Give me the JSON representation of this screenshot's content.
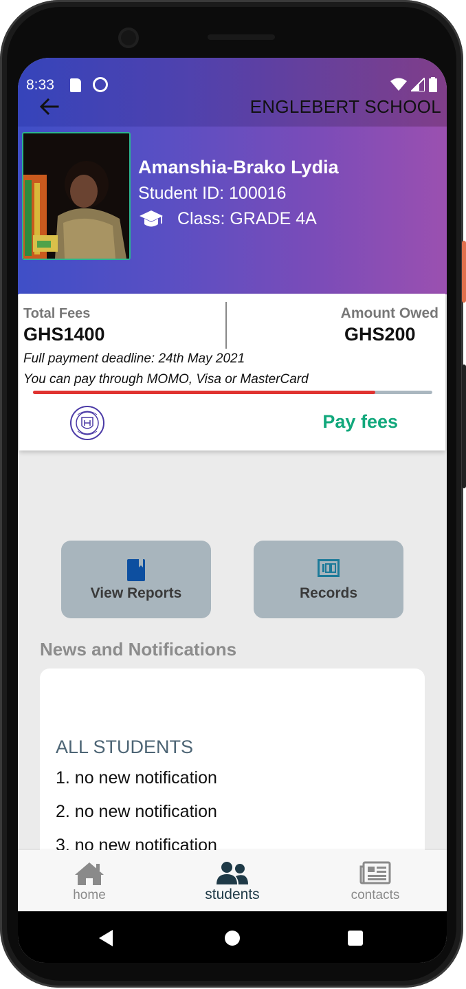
{
  "status_bar": {
    "time": "8:33"
  },
  "app_bar": {
    "title": "ENGLEBERT SCHOOL"
  },
  "student": {
    "name": "Amanshia-Brako Lydia",
    "id_text": "Student ID: 100016",
    "class_text": "Class: GRADE 4A"
  },
  "fees": {
    "total_label": "Total Fees",
    "total_value": "GHS1400",
    "owed_label": "Amount Owed",
    "owed_value": "GHS200",
    "deadline": "Full payment deadline: 24th May 2021",
    "payment_methods": "You can pay through MOMO, Visa or MasterCard",
    "progress_fraction": 0.857,
    "pay_button": "Pay fees"
  },
  "actions": {
    "view_reports": "View Reports",
    "records": "Records"
  },
  "news": {
    "title": "News and Notifications",
    "heading": "ALL STUDENTS",
    "items": [
      "1. no new notification",
      "2. no new notification",
      "3. no new notification"
    ]
  },
  "bottom_nav": {
    "home": "home",
    "students": "students",
    "contacts": "contacts"
  },
  "colors": {
    "accent_green": "#12a87c",
    "progress_red": "#e03331",
    "active_nav": "#1f3a47",
    "inactive_nav": "#8a8a8a"
  },
  "icons": [
    "back-arrow-icon",
    "graduation-cap-icon",
    "book-icon",
    "records-icon",
    "home-icon",
    "students-icon",
    "newspaper-icon"
  ]
}
